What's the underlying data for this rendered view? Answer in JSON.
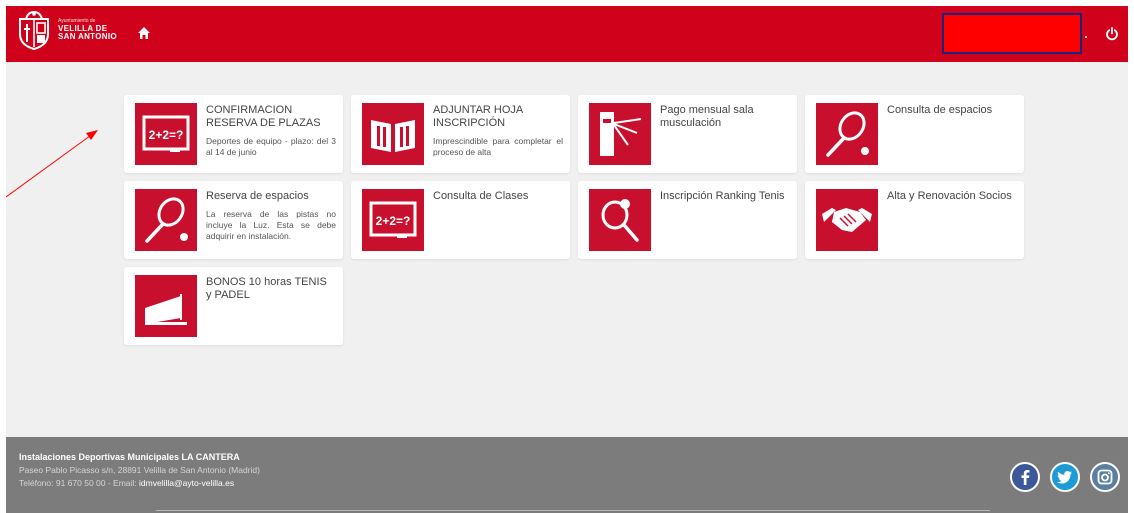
{
  "header": {
    "logo": {
      "line_small": "Ayuntamiento de",
      "line1": "VELILLA DE",
      "line2": "SAN ANTONIO"
    },
    "icons": {
      "home": "home-icon",
      "power": "power-icon"
    },
    "user_redacted": true
  },
  "cards": [
    {
      "title": "CONFIRMACION RESERVA DE PLAZAS",
      "desc": "Deportes de equipo - plazo: del 3 al 14 de junio",
      "icon": "math-board-icon"
    },
    {
      "title": "ADJUNTAR HOJA INSCRIPCIÓN",
      "desc": "Imprescindible para completar el proceso de alta",
      "icon": "open-book-icon"
    },
    {
      "title": "Pago mensual sala musculación",
      "desc": "",
      "icon": "turnstile-icon"
    },
    {
      "title": "Consulta de espacios",
      "desc": "",
      "icon": "tennis-racket-icon"
    },
    {
      "title": "Reserva de espacios",
      "desc": "La reserva de las pistas no incluye la Luz. Esta se debe adquirir en instalación.",
      "icon": "tennis-racket-icon"
    },
    {
      "title": "Consulta de Clases",
      "desc": "",
      "icon": "math-board-icon"
    },
    {
      "title": "Inscripción Ranking Tenis",
      "desc": "",
      "icon": "racket-ball-icon"
    },
    {
      "title": "Alta y Renovación Socios",
      "desc": "",
      "icon": "handshake-icon"
    },
    {
      "title": "BONOS 10 horas TENIS y PADEL",
      "desc": "",
      "icon": "court-icon"
    }
  ],
  "footer": {
    "title": "Instalaciones Deportivas Municipales LA CANTERA",
    "address": "Paseo Pablo Picasso s/n, 28891 Velilla de San Antonio (Madrid)",
    "phone_prefix": "Teléfono: 91 670 50 00 - Email: ",
    "email": "idmvelilla@ayto-velilla.es",
    "social": [
      "facebook-icon",
      "twitter-icon",
      "instagram-icon"
    ]
  },
  "colors": {
    "header": "#d0021b",
    "tile": "#c8102e",
    "footer": "#7c7c7c",
    "background": "#f0f0f0",
    "annotation": "#ff0000"
  }
}
